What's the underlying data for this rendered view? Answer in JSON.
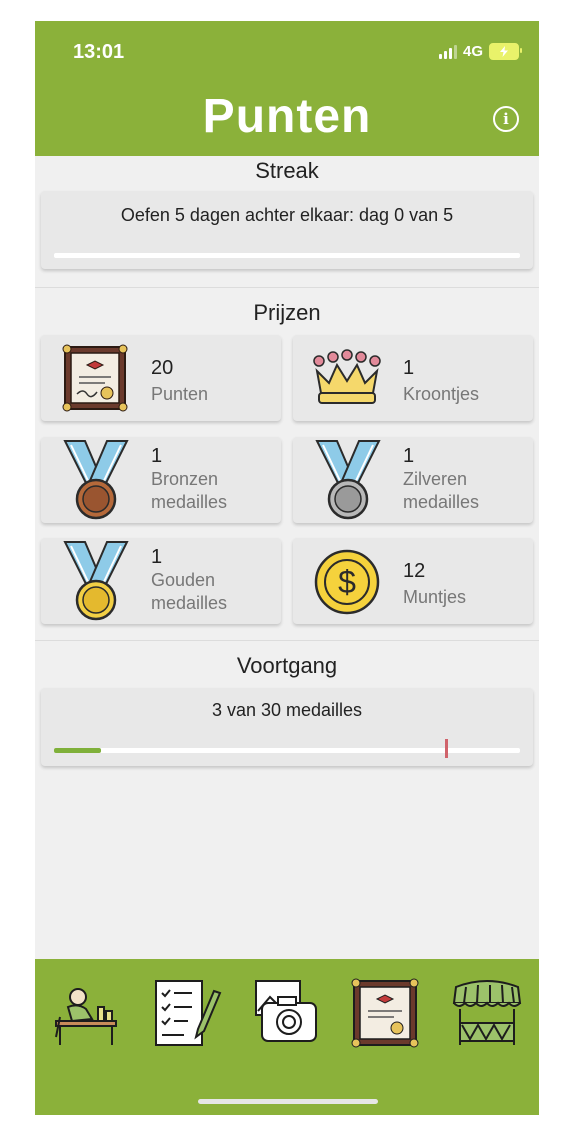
{
  "status_bar": {
    "time": "13:01",
    "network": "4G"
  },
  "header": {
    "title": "Punten"
  },
  "streak": {
    "section_title": "Streak",
    "text": "Oefen 5 dagen achter elkaar: dag 0 van 5",
    "progress_fraction": 0
  },
  "prizes": {
    "section_title": "Prijzen",
    "items": [
      {
        "count": "20",
        "label": "Punten",
        "icon": "certificate-icon"
      },
      {
        "count": "1",
        "label": "Kroontjes",
        "icon": "crown-icon"
      },
      {
        "count": "1",
        "label": "Bronzen medailles",
        "icon": "bronze-medal-icon"
      },
      {
        "count": "1",
        "label": "Zilveren medailles",
        "icon": "silver-medal-icon"
      },
      {
        "count": "1",
        "label": "Gouden medailles",
        "icon": "gold-medal-icon"
      },
      {
        "count": "12",
        "label": "Muntjes",
        "icon": "coin-icon"
      }
    ]
  },
  "progress": {
    "section_title": "Voortgang",
    "text": "3 van 30 medailles",
    "current": 3,
    "total": 30,
    "marker_fraction": 0.84
  },
  "tabbar": {
    "tabs": [
      "student-desk-icon",
      "checklist-icon",
      "camera-photo-icon",
      "certificate-icon",
      "market-stall-icon"
    ],
    "active": 3
  },
  "colors": {
    "brand_green": "#8bb13a",
    "progress_green": "#7fb03a",
    "marker_red": "#d0636b",
    "card_bg": "#e8e8e8"
  }
}
